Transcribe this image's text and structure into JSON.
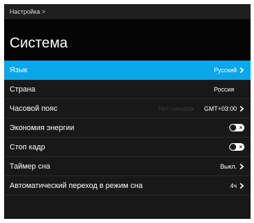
{
  "breadcrumb": "Настройка >",
  "page_title": "Система",
  "ghost_text": "Нет сигнала",
  "rows": [
    {
      "label": "Язык",
      "value": "Русский",
      "kind": "chevron",
      "selected": true
    },
    {
      "label": "Страна",
      "value": "Россия",
      "kind": "value"
    },
    {
      "label": "Часовой пояс",
      "value": "GMT+03:00",
      "kind": "chevron"
    },
    {
      "label": "Экономия энергии",
      "kind": "toggle",
      "toggle_on": false
    },
    {
      "label": "Стоп кадр",
      "kind": "toggle",
      "toggle_on": false
    },
    {
      "label": "Таймер сна",
      "value": "Выкл.",
      "kind": "chevron"
    },
    {
      "label": "Автоматический переход в режим сна",
      "value": "4ч",
      "kind": "chevron"
    }
  ],
  "colors": {
    "accent": "#0aa7ea",
    "background": "#181818",
    "header_background": "#050505"
  }
}
